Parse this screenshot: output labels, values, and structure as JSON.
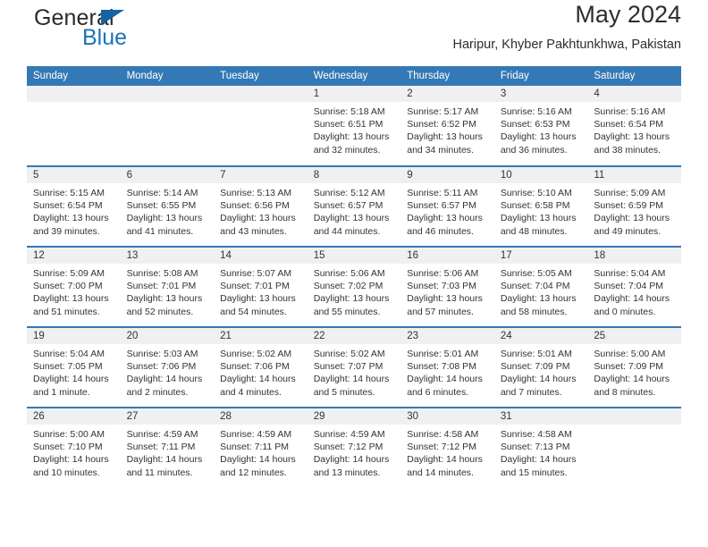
{
  "brand": {
    "name_top": "General",
    "name_bottom": "Blue"
  },
  "header": {
    "title": "May 2024",
    "subtitle": "Haripur, Khyber Pakhtunkhwa, Pakistan"
  },
  "colors": {
    "header_blue": "#3479b5",
    "brand_blue": "#1a73b8",
    "daynum_band": "#f0f0f0",
    "text": "#333333"
  },
  "weekdays": [
    "Sunday",
    "Monday",
    "Tuesday",
    "Wednesday",
    "Thursday",
    "Friday",
    "Saturday"
  ],
  "weeks": [
    [
      {
        "day": "",
        "sunrise": "",
        "sunset": "",
        "daylight_line1": "",
        "daylight_line2": ""
      },
      {
        "day": "",
        "sunrise": "",
        "sunset": "",
        "daylight_line1": "",
        "daylight_line2": ""
      },
      {
        "day": "",
        "sunrise": "",
        "sunset": "",
        "daylight_line1": "",
        "daylight_line2": ""
      },
      {
        "day": "1",
        "sunrise": "Sunrise: 5:18 AM",
        "sunset": "Sunset: 6:51 PM",
        "daylight_line1": "Daylight: 13 hours",
        "daylight_line2": "and 32 minutes."
      },
      {
        "day": "2",
        "sunrise": "Sunrise: 5:17 AM",
        "sunset": "Sunset: 6:52 PM",
        "daylight_line1": "Daylight: 13 hours",
        "daylight_line2": "and 34 minutes."
      },
      {
        "day": "3",
        "sunrise": "Sunrise: 5:16 AM",
        "sunset": "Sunset: 6:53 PM",
        "daylight_line1": "Daylight: 13 hours",
        "daylight_line2": "and 36 minutes."
      },
      {
        "day": "4",
        "sunrise": "Sunrise: 5:16 AM",
        "sunset": "Sunset: 6:54 PM",
        "daylight_line1": "Daylight: 13 hours",
        "daylight_line2": "and 38 minutes."
      }
    ],
    [
      {
        "day": "5",
        "sunrise": "Sunrise: 5:15 AM",
        "sunset": "Sunset: 6:54 PM",
        "daylight_line1": "Daylight: 13 hours",
        "daylight_line2": "and 39 minutes."
      },
      {
        "day": "6",
        "sunrise": "Sunrise: 5:14 AM",
        "sunset": "Sunset: 6:55 PM",
        "daylight_line1": "Daylight: 13 hours",
        "daylight_line2": "and 41 minutes."
      },
      {
        "day": "7",
        "sunrise": "Sunrise: 5:13 AM",
        "sunset": "Sunset: 6:56 PM",
        "daylight_line1": "Daylight: 13 hours",
        "daylight_line2": "and 43 minutes."
      },
      {
        "day": "8",
        "sunrise": "Sunrise: 5:12 AM",
        "sunset": "Sunset: 6:57 PM",
        "daylight_line1": "Daylight: 13 hours",
        "daylight_line2": "and 44 minutes."
      },
      {
        "day": "9",
        "sunrise": "Sunrise: 5:11 AM",
        "sunset": "Sunset: 6:57 PM",
        "daylight_line1": "Daylight: 13 hours",
        "daylight_line2": "and 46 minutes."
      },
      {
        "day": "10",
        "sunrise": "Sunrise: 5:10 AM",
        "sunset": "Sunset: 6:58 PM",
        "daylight_line1": "Daylight: 13 hours",
        "daylight_line2": "and 48 minutes."
      },
      {
        "day": "11",
        "sunrise": "Sunrise: 5:09 AM",
        "sunset": "Sunset: 6:59 PM",
        "daylight_line1": "Daylight: 13 hours",
        "daylight_line2": "and 49 minutes."
      }
    ],
    [
      {
        "day": "12",
        "sunrise": "Sunrise: 5:09 AM",
        "sunset": "Sunset: 7:00 PM",
        "daylight_line1": "Daylight: 13 hours",
        "daylight_line2": "and 51 minutes."
      },
      {
        "day": "13",
        "sunrise": "Sunrise: 5:08 AM",
        "sunset": "Sunset: 7:01 PM",
        "daylight_line1": "Daylight: 13 hours",
        "daylight_line2": "and 52 minutes."
      },
      {
        "day": "14",
        "sunrise": "Sunrise: 5:07 AM",
        "sunset": "Sunset: 7:01 PM",
        "daylight_line1": "Daylight: 13 hours",
        "daylight_line2": "and 54 minutes."
      },
      {
        "day": "15",
        "sunrise": "Sunrise: 5:06 AM",
        "sunset": "Sunset: 7:02 PM",
        "daylight_line1": "Daylight: 13 hours",
        "daylight_line2": "and 55 minutes."
      },
      {
        "day": "16",
        "sunrise": "Sunrise: 5:06 AM",
        "sunset": "Sunset: 7:03 PM",
        "daylight_line1": "Daylight: 13 hours",
        "daylight_line2": "and 57 minutes."
      },
      {
        "day": "17",
        "sunrise": "Sunrise: 5:05 AM",
        "sunset": "Sunset: 7:04 PM",
        "daylight_line1": "Daylight: 13 hours",
        "daylight_line2": "and 58 minutes."
      },
      {
        "day": "18",
        "sunrise": "Sunrise: 5:04 AM",
        "sunset": "Sunset: 7:04 PM",
        "daylight_line1": "Daylight: 14 hours",
        "daylight_line2": "and 0 minutes."
      }
    ],
    [
      {
        "day": "19",
        "sunrise": "Sunrise: 5:04 AM",
        "sunset": "Sunset: 7:05 PM",
        "daylight_line1": "Daylight: 14 hours",
        "daylight_line2": "and 1 minute."
      },
      {
        "day": "20",
        "sunrise": "Sunrise: 5:03 AM",
        "sunset": "Sunset: 7:06 PM",
        "daylight_line1": "Daylight: 14 hours",
        "daylight_line2": "and 2 minutes."
      },
      {
        "day": "21",
        "sunrise": "Sunrise: 5:02 AM",
        "sunset": "Sunset: 7:06 PM",
        "daylight_line1": "Daylight: 14 hours",
        "daylight_line2": "and 4 minutes."
      },
      {
        "day": "22",
        "sunrise": "Sunrise: 5:02 AM",
        "sunset": "Sunset: 7:07 PM",
        "daylight_line1": "Daylight: 14 hours",
        "daylight_line2": "and 5 minutes."
      },
      {
        "day": "23",
        "sunrise": "Sunrise: 5:01 AM",
        "sunset": "Sunset: 7:08 PM",
        "daylight_line1": "Daylight: 14 hours",
        "daylight_line2": "and 6 minutes."
      },
      {
        "day": "24",
        "sunrise": "Sunrise: 5:01 AM",
        "sunset": "Sunset: 7:09 PM",
        "daylight_line1": "Daylight: 14 hours",
        "daylight_line2": "and 7 minutes."
      },
      {
        "day": "25",
        "sunrise": "Sunrise: 5:00 AM",
        "sunset": "Sunset: 7:09 PM",
        "daylight_line1": "Daylight: 14 hours",
        "daylight_line2": "and 8 minutes."
      }
    ],
    [
      {
        "day": "26",
        "sunrise": "Sunrise: 5:00 AM",
        "sunset": "Sunset: 7:10 PM",
        "daylight_line1": "Daylight: 14 hours",
        "daylight_line2": "and 10 minutes."
      },
      {
        "day": "27",
        "sunrise": "Sunrise: 4:59 AM",
        "sunset": "Sunset: 7:11 PM",
        "daylight_line1": "Daylight: 14 hours",
        "daylight_line2": "and 11 minutes."
      },
      {
        "day": "28",
        "sunrise": "Sunrise: 4:59 AM",
        "sunset": "Sunset: 7:11 PM",
        "daylight_line1": "Daylight: 14 hours",
        "daylight_line2": "and 12 minutes."
      },
      {
        "day": "29",
        "sunrise": "Sunrise: 4:59 AM",
        "sunset": "Sunset: 7:12 PM",
        "daylight_line1": "Daylight: 14 hours",
        "daylight_line2": "and 13 minutes."
      },
      {
        "day": "30",
        "sunrise": "Sunrise: 4:58 AM",
        "sunset": "Sunset: 7:12 PM",
        "daylight_line1": "Daylight: 14 hours",
        "daylight_line2": "and 14 minutes."
      },
      {
        "day": "31",
        "sunrise": "Sunrise: 4:58 AM",
        "sunset": "Sunset: 7:13 PM",
        "daylight_line1": "Daylight: 14 hours",
        "daylight_line2": "and 15 minutes."
      },
      {
        "day": "",
        "sunrise": "",
        "sunset": "",
        "daylight_line1": "",
        "daylight_line2": ""
      }
    ]
  ]
}
